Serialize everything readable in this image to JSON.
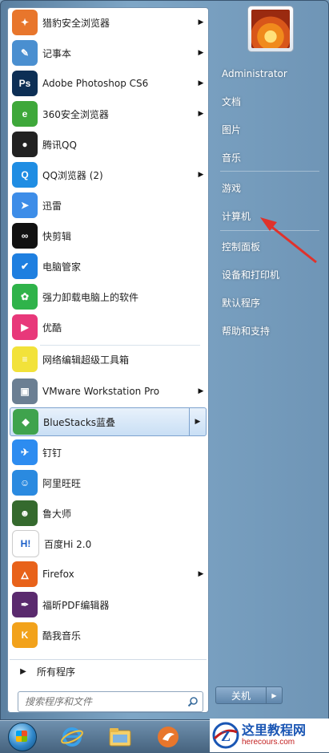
{
  "programs": [
    {
      "label": "猎豹安全浏览器",
      "icon": "cheetah-browser-icon",
      "has_submenu": true,
      "color": "#e8762c",
      "glyph": "✦"
    },
    {
      "label": "记事本",
      "icon": "notepad-icon",
      "has_submenu": true,
      "color": "#4a8fd0",
      "glyph": "✎"
    },
    {
      "label": "Adobe Photoshop CS6",
      "icon": "photoshop-icon",
      "has_submenu": true,
      "color": "#0d2f55",
      "glyph": "Ps"
    },
    {
      "label": "360安全浏览器",
      "icon": "360-browser-icon",
      "has_submenu": true,
      "color": "#3ea83a",
      "glyph": "e"
    },
    {
      "label": "腾讯QQ",
      "icon": "qq-penguin-icon",
      "has_submenu": false,
      "color": "#222222",
      "glyph": "●"
    },
    {
      "label": "QQ浏览器 (2)",
      "icon": "qq-browser-icon",
      "has_submenu": true,
      "color": "#1f8de3",
      "glyph": "Q"
    },
    {
      "label": "迅雷",
      "icon": "xunlei-icon",
      "has_submenu": false,
      "color": "#3d8de8",
      "glyph": "➤"
    },
    {
      "label": "快剪辑",
      "icon": "kuaijianji-icon",
      "has_submenu": false,
      "color": "#111111",
      "glyph": "∞"
    },
    {
      "label": "电脑管家",
      "icon": "pc-manager-shield-icon",
      "has_submenu": false,
      "color": "#1e7fe0",
      "glyph": "✔"
    },
    {
      "label": "强力卸载电脑上的软件",
      "icon": "uninstall-clover-icon",
      "has_submenu": false,
      "color": "#2fb34a",
      "glyph": "✿"
    },
    {
      "label": "优酷",
      "icon": "youku-icon",
      "has_submenu": false,
      "color": "#e8387a",
      "glyph": "▶"
    },
    {
      "label": "网络编辑超级工具箱",
      "icon": "toolbox-stripes-icon",
      "has_submenu": false,
      "color": "#f2e23a",
      "glyph": "≡"
    },
    {
      "label": "VMware Workstation Pro",
      "icon": "vmware-icon",
      "has_submenu": true,
      "color": "#6b7f93",
      "glyph": "▣"
    },
    {
      "label": "BlueStacks蓝叠",
      "icon": "bluestacks-icon",
      "has_submenu": true,
      "color": "#3fa34d",
      "glyph": "◆",
      "highlighted": true
    },
    {
      "label": "钉钉",
      "icon": "dingtalk-icon",
      "has_submenu": false,
      "color": "#2d8cf0",
      "glyph": "✈"
    },
    {
      "label": "阿里旺旺",
      "icon": "aliwangwang-icon",
      "has_submenu": false,
      "color": "#2a8ae0",
      "glyph": "☺"
    },
    {
      "label": "鲁大师",
      "icon": "ludashi-icon",
      "has_submenu": false,
      "color": "#356a2e",
      "glyph": "☻"
    },
    {
      "label": "百度Hi 2.0",
      "icon": "baidu-hi-icon",
      "has_submenu": false,
      "color": "#ffffff",
      "glyph": "H!",
      "glyph_color": "#1b5fc8"
    },
    {
      "label": "Firefox",
      "icon": "firefox-icon",
      "has_submenu": true,
      "color": "#e8621a",
      "glyph": "🜂"
    },
    {
      "label": "福昕PDF编辑器",
      "icon": "foxit-pdf-icon",
      "has_submenu": false,
      "color": "#5a2a6e",
      "glyph": "✒"
    },
    {
      "label": "酷我音乐",
      "icon": "kuwo-music-icon",
      "has_submenu": false,
      "color": "#f2a21b",
      "glyph": "K"
    }
  ],
  "all_programs": {
    "label": "所有程序"
  },
  "search": {
    "placeholder": "搜索程序和文件"
  },
  "right_items": [
    {
      "label": "Administrator",
      "name": "user-name-link"
    },
    {
      "label": "文档",
      "name": "documents-link"
    },
    {
      "label": "图片",
      "name": "pictures-link"
    },
    {
      "label": "音乐",
      "name": "music-link"
    },
    {
      "label": "游戏",
      "name": "games-link"
    },
    {
      "label": "计算机",
      "name": "computer-link"
    },
    {
      "label": "控制面板",
      "name": "control-panel-link"
    },
    {
      "label": "设备和打印机",
      "name": "devices-printers-link"
    },
    {
      "label": "默认程序",
      "name": "default-programs-link"
    },
    {
      "label": "帮助和支持",
      "name": "help-support-link"
    }
  ],
  "shutdown": {
    "label": "关机"
  },
  "watermark": {
    "title": "这里教程网",
    "url": "herecours.com",
    "logo_letter": "Z"
  },
  "colors": {
    "annotation_arrow": "#e0322b",
    "menu_blue": "#6f95b6"
  }
}
